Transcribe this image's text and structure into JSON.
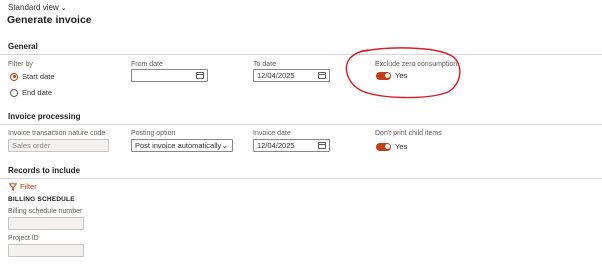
{
  "header": {
    "view_label": "Standard view",
    "page_title": "Generate invoice"
  },
  "general": {
    "section_title": "General",
    "filter_by": {
      "label": "Filter by",
      "options": [
        "Start date",
        "End date"
      ],
      "selected": "Start date"
    },
    "from_date": {
      "label": "From date",
      "value": ""
    },
    "to_date": {
      "label": "To date",
      "value": "12/04/2025"
    },
    "exclude_zero": {
      "label": "Exclude zero consumption",
      "value": "Yes",
      "on": true
    }
  },
  "invoice_processing": {
    "section_title": "Invoice processing",
    "nature_code": {
      "label": "Invoice transaction nature code",
      "placeholder": "Sales order"
    },
    "posting_option": {
      "label": "Posting option",
      "value": "Post invoice automatically"
    },
    "invoice_date": {
      "label": "Invoice date",
      "value": "12/04/2025"
    },
    "dont_print_child": {
      "label": "Don't print child items",
      "value": "Yes",
      "on": true
    }
  },
  "records": {
    "section_title": "Records to include",
    "filter_label": "Filter",
    "group_title": "BILLING SCHEDULE",
    "fields": [
      {
        "label": "Billing schedule number",
        "value": ""
      },
      {
        "label": "Project ID",
        "value": ""
      }
    ]
  },
  "colors": {
    "accent": "#c23c16",
    "annotation": "#e01b24"
  }
}
